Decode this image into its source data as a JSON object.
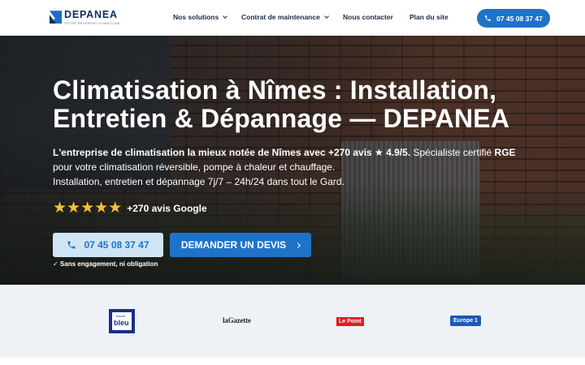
{
  "header": {
    "logo": {
      "name": "DEPANEA",
      "tagline": "Votre référent climatique"
    },
    "nav": [
      {
        "label": "Nos solutions",
        "has_dropdown": true
      },
      {
        "label": "Contrat de maintenance",
        "has_dropdown": true
      },
      {
        "label": "Nous contacter",
        "has_dropdown": false
      },
      {
        "label": "Plan du site",
        "has_dropdown": false
      }
    ],
    "phone_button": {
      "label": "07 45 08 37 47",
      "icon": "phone-icon"
    }
  },
  "hero": {
    "title": "Climatisation à Nîmes : Installation, Entretien & Dépannage — DEPANEA",
    "description": {
      "bold1": "L'entreprise de climatisation la mieux notée de Nîmes avec +270 avis ★ 4.9/5.",
      "text1": " Spécialiste certifié ",
      "bold2": "RGE",
      "text2": " pour votre climatisation réversible, pompe à chaleur et chauffage.",
      "line3": "Installation, entretien et dépannage 7j/7 – 24h/24 dans tout le Gard."
    },
    "rating": {
      "stars": 5,
      "label": "+270 avis Google"
    },
    "call_button": {
      "label": "07 45 08 37 47",
      "icon": "phone-icon"
    },
    "quote_button": {
      "label": "DEMANDER UN DEVIS",
      "icon": "chevron-right-icon"
    },
    "note": "✓ Sans engagement, ni obligation"
  },
  "press": {
    "logos": [
      {
        "name": "france bleu",
        "small": "france",
        "word": "bleu"
      },
      {
        "name": "la Gazette",
        "text": "laGazette"
      },
      {
        "name": "Le Point",
        "text": "Le Point"
      },
      {
        "name": "Europe 1",
        "text": "Europe 1"
      }
    ]
  },
  "colors": {
    "brand_blue": "#1f73c7",
    "navy": "#0d2d5a",
    "star_gold": "#f2c230",
    "call_button_bg": "#cfe5f6",
    "press_band_bg": "#eef1f6"
  }
}
